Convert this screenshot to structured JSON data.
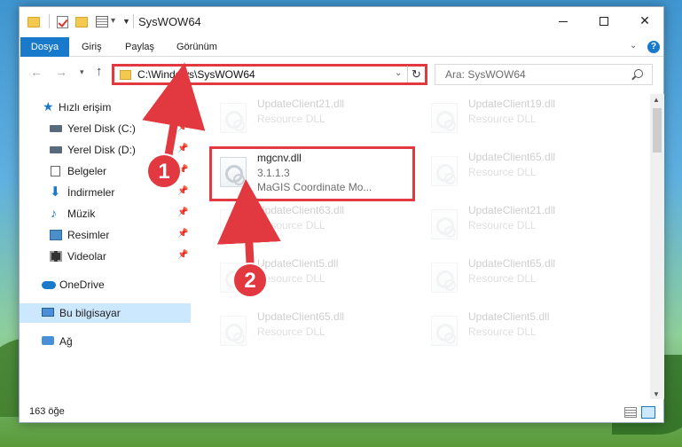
{
  "window": {
    "title": "SysWOW64",
    "controls": {
      "minimize": "",
      "maximize": "",
      "close": "✕"
    }
  },
  "ribbon": {
    "tabs": [
      "Dosya",
      "Giriş",
      "Paylaş",
      "Görünüm"
    ],
    "help": "?"
  },
  "navigation": {
    "address": "C:\\Windows\\SysWOW64",
    "search_placeholder": "Ara: SysWOW64"
  },
  "sidebar": {
    "quick_access": "Hızlı erişim",
    "items": [
      {
        "label": "Yerel Disk (C:)",
        "icon": "disk-icon",
        "pinned": true
      },
      {
        "label": "Yerel Disk (D:)",
        "icon": "disk-icon",
        "pinned": true
      },
      {
        "label": "Belgeler",
        "icon": "documents-icon",
        "pinned": true
      },
      {
        "label": "İndirmeler",
        "icon": "downloads-icon",
        "pinned": true
      },
      {
        "label": "Müzik",
        "icon": "music-icon",
        "pinned": true
      },
      {
        "label": "Resimler",
        "icon": "pictures-icon",
        "pinned": true
      },
      {
        "label": "Videolar",
        "icon": "videos-icon",
        "pinned": true
      }
    ],
    "onedrive": "OneDrive",
    "this_pc": "Bu bilgisayar",
    "network": "Ağ"
  },
  "files": {
    "left": [
      {
        "name": "UpdateClient21.dll",
        "line2": "Resource DLL"
      },
      {
        "name": "mgcnv.dll",
        "line2": "3.1.1.3",
        "line3": "MaGIS Coordinate Mo..."
      },
      {
        "name": "UpdateClient63.dll",
        "line2": "Resource DLL"
      },
      {
        "name": "UpdateClient5.dll",
        "line2": "Resource DLL"
      },
      {
        "name": "UpdateClient65.dll",
        "line2": "Resource DLL"
      }
    ],
    "right": [
      {
        "name": "UpdateClient19.dll",
        "line2": "Resource DLL"
      },
      {
        "name": "UpdateClient65.dll",
        "line2": "Resource DLL"
      },
      {
        "name": "UpdateClient21.dll",
        "line2": "Resource DLL"
      },
      {
        "name": "UpdateClient65.dll",
        "line2": "Resource DLL"
      },
      {
        "name": "UpdateClient5.dll",
        "line2": "Resource DLL"
      }
    ]
  },
  "status": {
    "item_count": "163 öğe"
  },
  "annotations": {
    "marker1": "1",
    "marker2": "2",
    "highlight_color": "#e2383f"
  }
}
